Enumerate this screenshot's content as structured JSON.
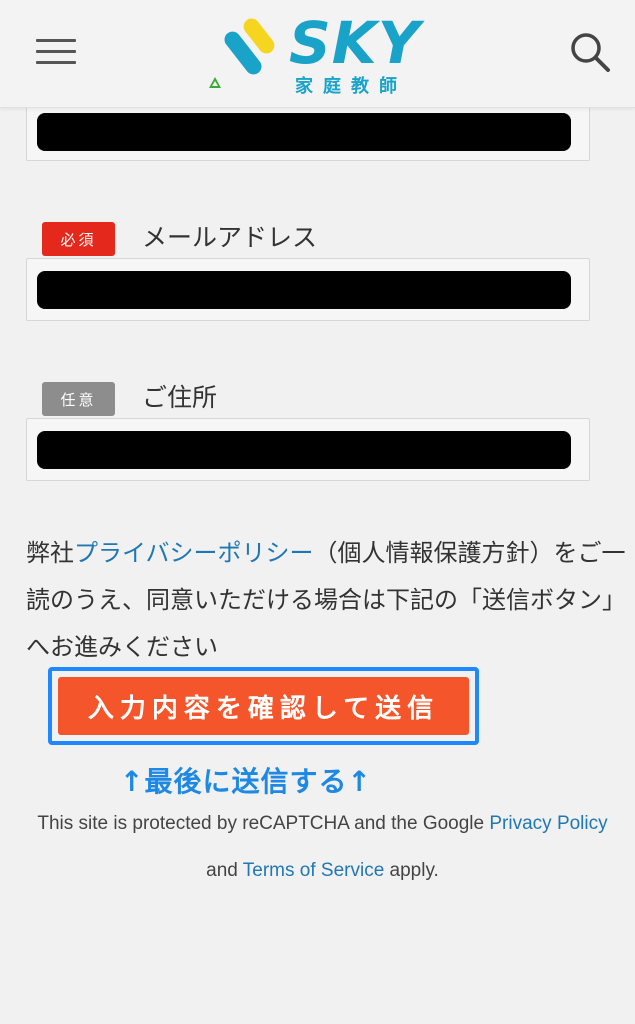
{
  "header": {
    "logo_text": "SKY",
    "logo_subtitle": "家庭教師",
    "brand_color": "#1aa3c9",
    "menu_icon": "hamburger-icon",
    "search_icon": "search-icon"
  },
  "form": {
    "fields": [
      {
        "badge": "必須",
        "label": "メールアドレス",
        "value": ""
      },
      {
        "badge": "任意",
        "label": "ご住所",
        "value": ""
      }
    ],
    "previous_field_value": ""
  },
  "policy": {
    "prefix": "弊社",
    "link_label": "プライバシーポリシー",
    "rest": "（個人情報保護方針）をご一読のうえ、同意いただける場合は下記の「送信ボタン」へお進みください"
  },
  "submit": {
    "label": "入力内容を確認して送信",
    "color": "#f4552a",
    "frame_color": "#1e88ff"
  },
  "annotation": {
    "text": "↑最後に送信する↑"
  },
  "recaptcha": {
    "text1": "This site is protected by reCAPTCHA and the Google ",
    "privacy_link": "Privacy Policy",
    "and": " and ",
    "terms_link": "Terms of Service",
    "apply": " apply."
  }
}
